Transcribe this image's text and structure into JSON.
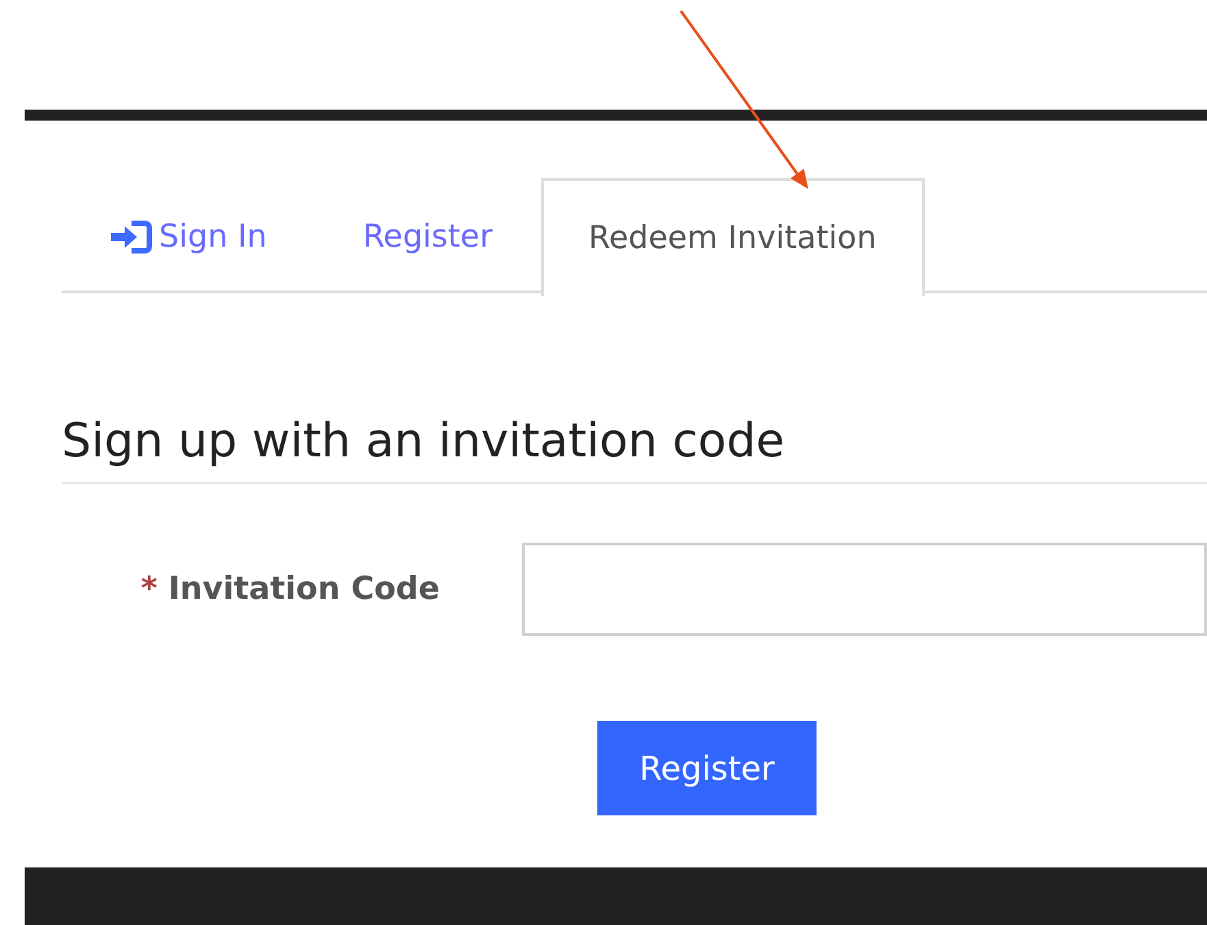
{
  "annotation": {
    "kind": "arrow"
  },
  "tabs": [
    {
      "label": "Sign In",
      "kind": "with-icon",
      "selected": false
    },
    {
      "label": "Register",
      "kind": "plain",
      "selected": false
    },
    {
      "label": "Redeem Invitation",
      "kind": "plain",
      "selected": true
    }
  ],
  "heading": "Sign up with an invitation code",
  "field": {
    "required_mark": "*",
    "label": "Invitation Code"
  },
  "submit_button": "Register"
}
